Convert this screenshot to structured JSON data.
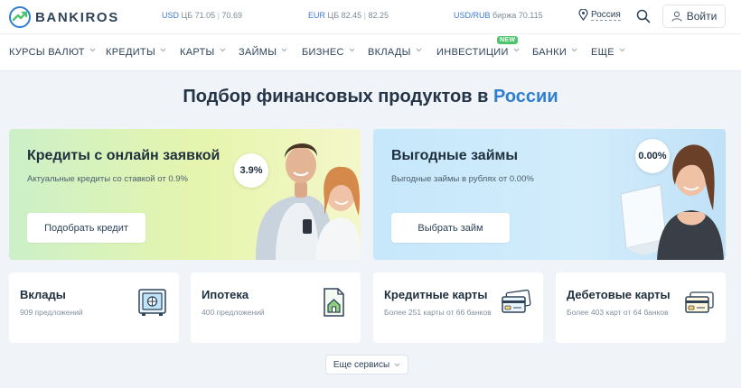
{
  "brand": {
    "name": "BANKIROS"
  },
  "rates": [
    {
      "currency": "USD",
      "source": "ЦБ",
      "buy": "71.05",
      "sell": "70.69"
    },
    {
      "currency": "EUR",
      "source": "ЦБ",
      "buy": "82.45",
      "sell": "82.25"
    },
    {
      "currency": "USD/RUB",
      "source": "биржа",
      "value": "70.115"
    }
  ],
  "header": {
    "region": "Россия",
    "login_label": "Войти"
  },
  "nav": {
    "items": [
      {
        "label": "КУРСЫ ВАЛЮТ"
      },
      {
        "label": "КРЕДИТЫ"
      },
      {
        "label": "КАРТЫ"
      },
      {
        "label": "ЗАЙМЫ"
      },
      {
        "label": "БИЗНЕС"
      },
      {
        "label": "ВКЛАДЫ"
      },
      {
        "label": "ИНВЕСТИЦИИ"
      },
      {
        "label": "БАНКИ"
      },
      {
        "label": "ЕЩЕ"
      }
    ],
    "new_badge": "NEW"
  },
  "heading": {
    "prefix": "Подбор финансовых продуктов в",
    "accent": "России"
  },
  "promos": [
    {
      "title": "Кредиты с онлайн заявкой",
      "subtitle": "Актуальные кредиты со ставкой от 0.9%",
      "button": "Подобрать кредит",
      "rate": "3.9%"
    },
    {
      "title": "Выгодные займы",
      "subtitle": "Выгодные займы в рублях от 0.00%",
      "button": "Выбрать займ",
      "rate": "0.00%"
    }
  ],
  "products": [
    {
      "title": "Вклады",
      "subtitle": "909 предложений",
      "icon": "safe-icon"
    },
    {
      "title": "Ипотека",
      "subtitle": "400 предложений",
      "icon": "house-document-icon"
    },
    {
      "title": "Кредитные карты",
      "subtitle": "Более 251 карты от 66 банков",
      "icon": "credit-card-icon"
    },
    {
      "title": "Дебетовые карты",
      "subtitle": "Более 403 карт от 64 банков",
      "icon": "debit-card-icon"
    }
  ],
  "more_services": "Еще сервисы",
  "colors": {
    "accent": "#2f7fd0",
    "brand_green": "#4cc56b",
    "nav_text": "#2e4358"
  }
}
